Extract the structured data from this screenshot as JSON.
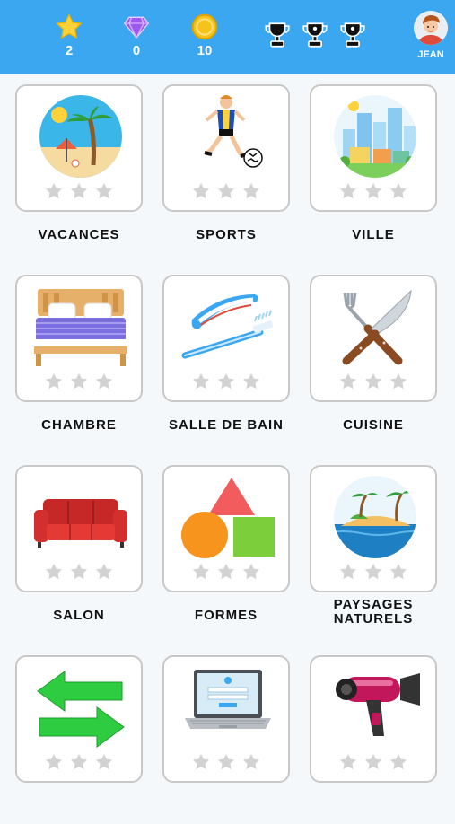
{
  "header": {
    "stars_count": "2",
    "gems_count": "0",
    "coins_count": "10",
    "trophies": [
      "trophy-icon",
      "trophy-icon",
      "trophy-icon"
    ],
    "user_name": "JEAN",
    "colors": {
      "bar": "#3aa7f0",
      "star": "#ffd23a",
      "gem": "#9b59f2",
      "coin": "#f7c21a"
    }
  },
  "categories": [
    {
      "label": "VACANCES",
      "icon": "beach-icon",
      "stars": 0
    },
    {
      "label": "SPORTS",
      "icon": "soccer-player-icon",
      "stars": 0
    },
    {
      "label": "VILLE",
      "icon": "city-icon",
      "stars": 0
    },
    {
      "label": "CHAMBRE",
      "icon": "bed-icon",
      "stars": 0
    },
    {
      "label": "SALLE DE BAIN",
      "icon": "toothbrush-icon",
      "stars": 0
    },
    {
      "label": "CUISINE",
      "icon": "fork-knife-icon",
      "stars": 0
    },
    {
      "label": "SALON",
      "icon": "sofa-icon",
      "stars": 0
    },
    {
      "label": "FORMES",
      "icon": "shapes-icon",
      "stars": 0
    },
    {
      "label_line1": "PAYSAGES",
      "label_line2": "NATURELS",
      "icon": "island-icon",
      "stars": 0
    },
    {
      "label": "",
      "icon": "arrows-icon",
      "stars": 0
    },
    {
      "label": "",
      "icon": "laptop-icon",
      "stars": 0
    },
    {
      "label": "",
      "icon": "hair-dryer-icon",
      "stars": 0
    }
  ]
}
